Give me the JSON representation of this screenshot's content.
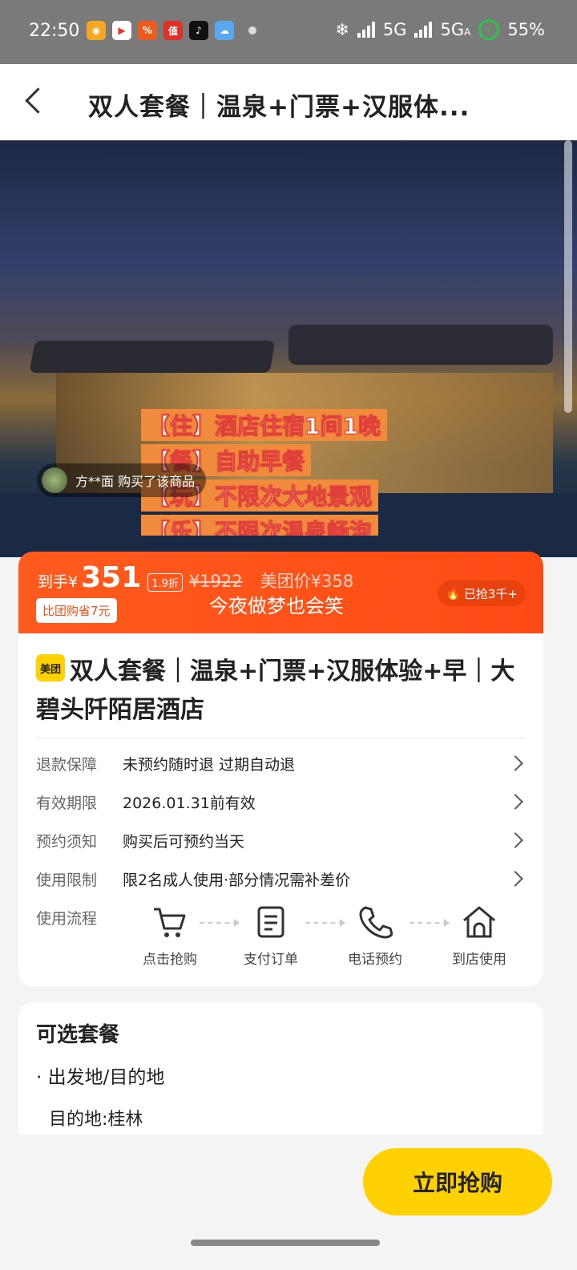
{
  "status_bar": {
    "time": "22:50",
    "network_1": "5G",
    "network_2": "5G",
    "network_2_sub": "A",
    "battery": "55%",
    "app_icons": [
      "weibo-icon",
      "video-icon",
      "shopping-icon",
      "zhide-icon",
      "tiktok-icon",
      "weather-icon"
    ]
  },
  "navbar": {
    "title": "双人套餐｜温泉+门票+汉服体..."
  },
  "hero": {
    "buyer_name": "方**面 购买了该商品",
    "tags": [
      "【住】酒店住宿1间1晚",
      "【餐】自助早餐",
      "【玩】不限次大地景观",
      "【乐】不限次温泉畅泡"
    ]
  },
  "price": {
    "prefix": "到手¥",
    "value": "351",
    "discount": "1.9折",
    "original": "¥1922",
    "meituan_price": "美团价¥358",
    "save_badge": "比团购省7元",
    "slogan": "今夜做梦也会笑",
    "grabbed": "已抢3千+"
  },
  "product": {
    "brand": "美团",
    "title": "双人套餐｜温泉+门票+汉服体验+早｜大碧头阡陌居酒店"
  },
  "info_rows": [
    {
      "label": "退款保障",
      "value": "未预约随时退 过期自动退"
    },
    {
      "label": "有效期限",
      "value": "2026.01.31前有效"
    },
    {
      "label": "预约须知",
      "value": "购买后可预约当天"
    },
    {
      "label": "使用限制",
      "value": "限2名成人使用·部分情况需补差价"
    }
  ],
  "flow": {
    "label": "使用流程",
    "steps": [
      "点击抢购",
      "支付订单",
      "电话预约",
      "到店使用"
    ]
  },
  "package": {
    "title": "可选套餐",
    "line1": "出发地/目的地",
    "line2": "目的地:桂林"
  },
  "cta": {
    "buy_label": "立即抢购"
  },
  "colors": {
    "accent_orange": "#ff4a14",
    "brand_yellow": "#ffd100"
  }
}
